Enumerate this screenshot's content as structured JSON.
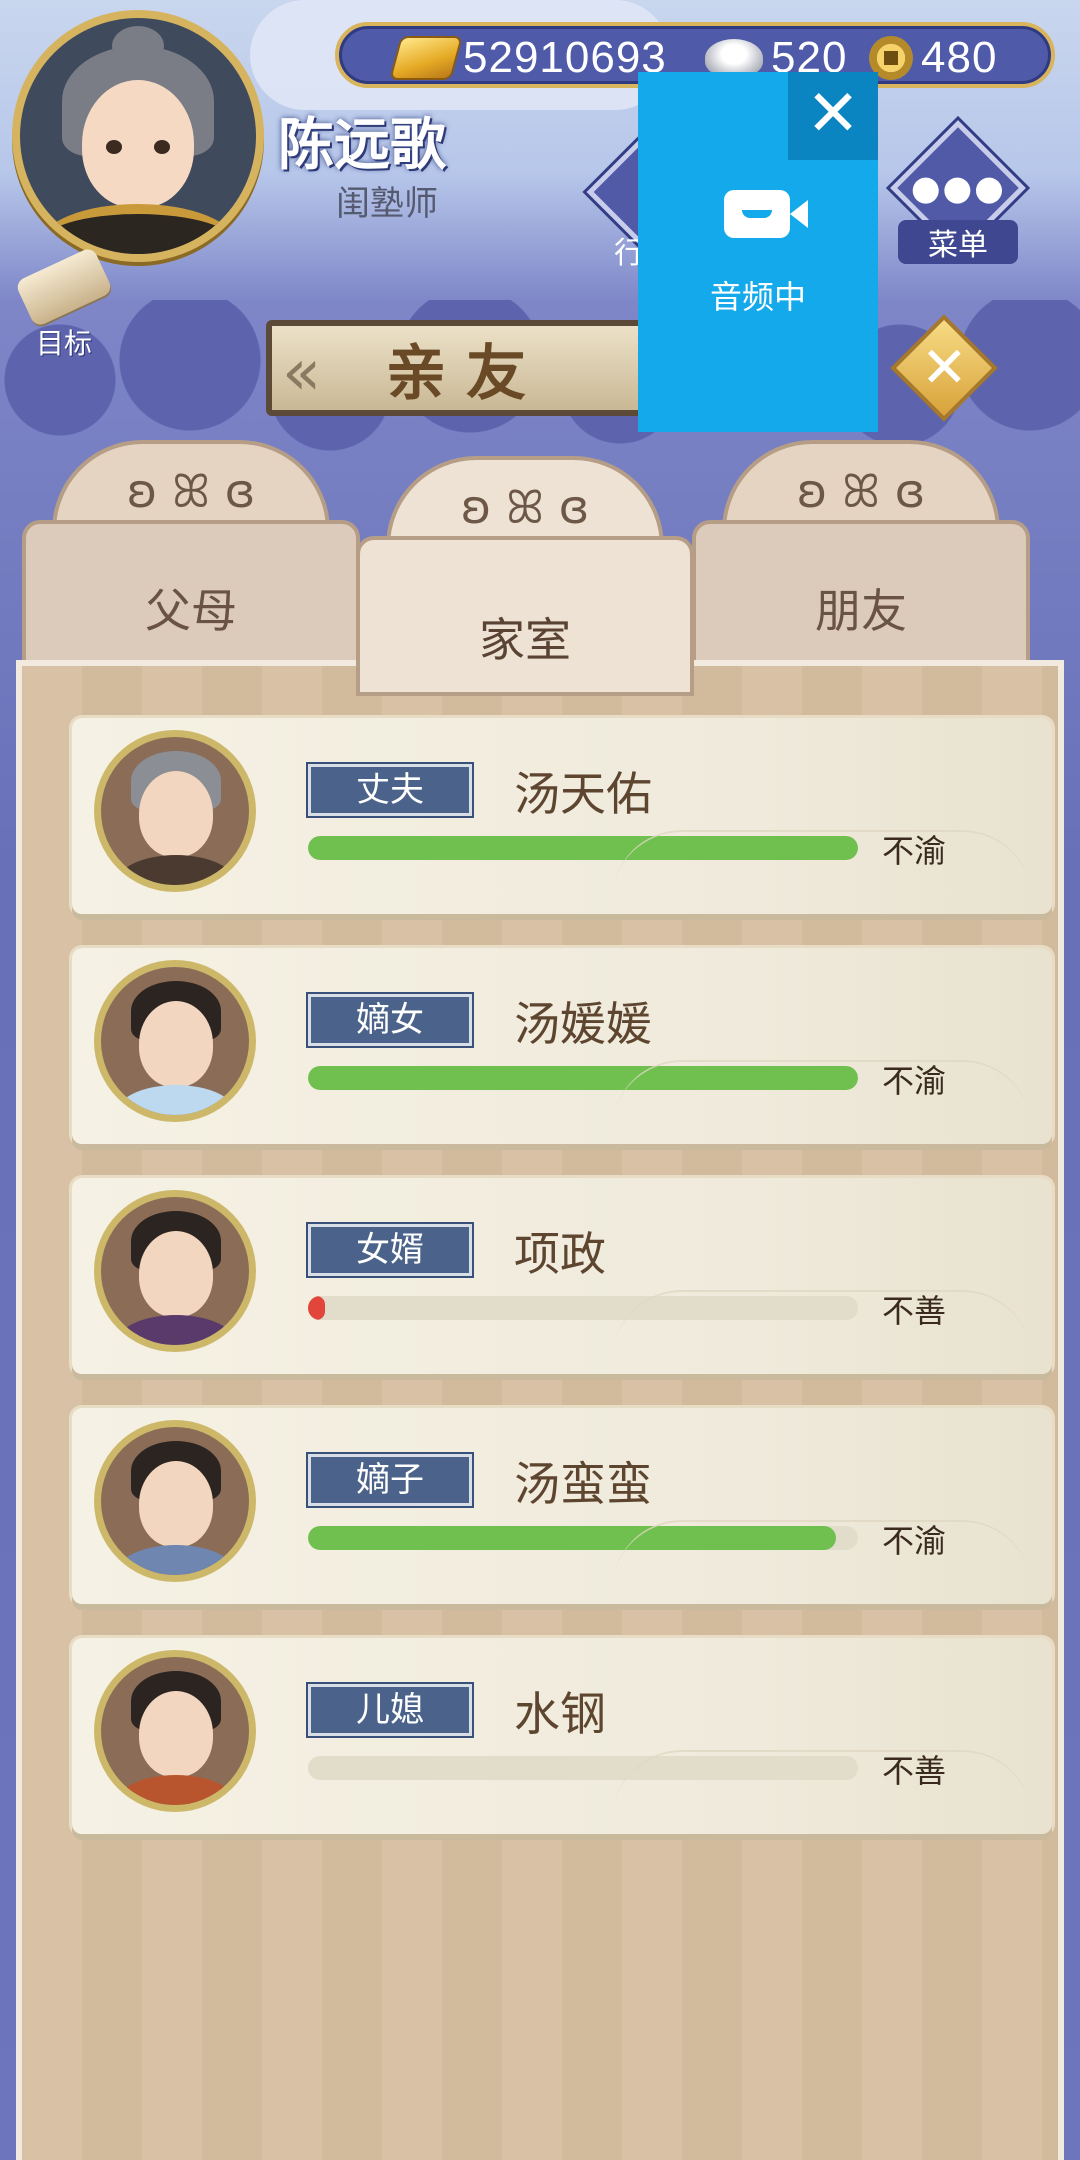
{
  "header": {
    "player_name": "陈远歌",
    "player_title": "闺塾师",
    "goal_label": "目标",
    "menu_label": "菜单",
    "menu_icon": "ellipsis-icon",
    "hidden_button_label": "行"
  },
  "currency": {
    "gold": "52910693",
    "silver": "520",
    "copper": "480"
  },
  "title": "亲友",
  "overlay": {
    "status_label": "音频中",
    "close_glyph": "✕",
    "icon": "video-camera-icon"
  },
  "tabs": [
    {
      "label": "父母",
      "active": false
    },
    {
      "label": "家室",
      "active": true
    },
    {
      "label": "朋友",
      "active": false
    }
  ],
  "relatives": [
    {
      "role": "丈夫",
      "name": "汤天佑",
      "mood": "不渝",
      "relation_level": 1.0,
      "bar_color": "#6fc04f"
    },
    {
      "role": "嫡女",
      "name": "汤媛媛",
      "mood": "不渝",
      "relation_level": 1.0,
      "bar_color": "#6fc04f"
    },
    {
      "role": "女婿",
      "name": "项政",
      "mood": "不善",
      "relation_level": 0.02,
      "bar_color": "#e2453a"
    },
    {
      "role": "嫡子",
      "name": "汤蛮蛮",
      "mood": "不渝",
      "relation_level": 0.96,
      "bar_color": "#6fc04f"
    },
    {
      "role": "儿媳",
      "name": "水钢",
      "mood": "不善",
      "relation_level": 0.0,
      "bar_color": "#6fc04f"
    }
  ],
  "colors": {
    "accent_gold": "#d8b45c",
    "panel_blue": "#4f5aa8",
    "overlay_blue": "#13a9ea",
    "relation_green": "#6fc04f",
    "relation_red": "#e2453a"
  }
}
